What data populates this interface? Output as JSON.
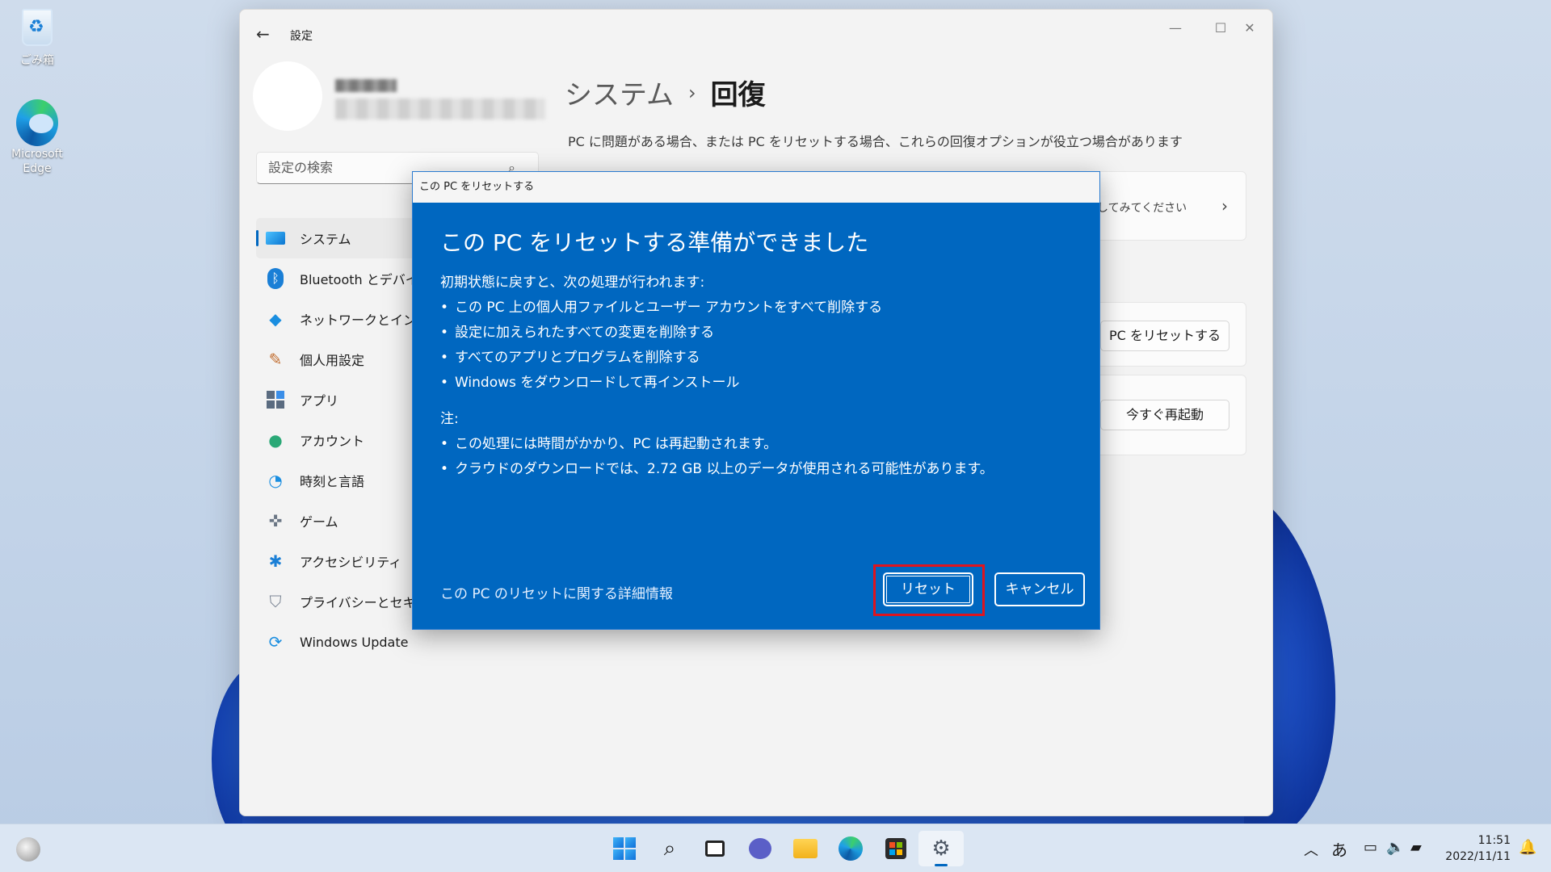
{
  "desktop": {
    "icons": [
      {
        "label": "ごみ箱",
        "icon": "recycle-bin-icon"
      },
      {
        "label": "Microsoft Edge",
        "icon": "edge-icon"
      }
    ]
  },
  "window": {
    "app_title": "設定",
    "search_placeholder": "設定の検索",
    "breadcrumb": {
      "parent": "システム",
      "separator": "›",
      "current": "回復"
    },
    "page_description": "PC に問題がある場合、または PC をリセットする場合、これらの回復オプションが役立つ場合があります",
    "nav": [
      {
        "label": "システム",
        "icon": "monitor-icon",
        "active": true
      },
      {
        "label": "Bluetooth とデバイス",
        "icon": "bluetooth-icon"
      },
      {
        "label": "ネットワークとインターネット",
        "icon": "wifi-icon"
      },
      {
        "label": "個人用設定",
        "icon": "brush-icon"
      },
      {
        "label": "アプリ",
        "icon": "apps-icon"
      },
      {
        "label": "アカウント",
        "icon": "account-icon"
      },
      {
        "label": "時刻と言語",
        "icon": "globe-clock-icon"
      },
      {
        "label": "ゲーム",
        "icon": "gamepad-icon"
      },
      {
        "label": "アクセシビリティ",
        "icon": "accessibility-icon"
      },
      {
        "label": "プライバシーとセキュリティ",
        "icon": "shield-icon"
      },
      {
        "label": "Windows Update",
        "icon": "update-icon"
      }
    ],
    "cards": {
      "troubleshoot_text": "決してみてください",
      "reset_button": "PC をリセットする",
      "restart_button": "今すぐ再起動"
    }
  },
  "dialog": {
    "title": "この PC をリセットする",
    "heading": "この PC をリセットする準備ができました",
    "intro": "初期状態に戻すと、次の処理が行われます:",
    "actions": [
      "この PC 上の個人用ファイルとユーザー アカウントをすべて削除する",
      "設定に加えられたすべての変更を削除する",
      "すべてのアプリとプログラムを削除する",
      "Windows をダウンロードして再インストール"
    ],
    "note_label": "注:",
    "notes": [
      "この処理には時間がかかり、PC は再起動されます。",
      "クラウドのダウンロードでは、2.72 GB 以上のデータが使用される可能性があります。"
    ],
    "link": "この PC のリセットに関する詳細情報",
    "reset_button": "リセット",
    "cancel_button": "キャンセル",
    "accent_color": "#0067c0",
    "highlight_color": "#e0141e"
  },
  "taskbar": {
    "apps": [
      "start-icon",
      "search-icon",
      "task-view-icon",
      "chat-icon",
      "file-explorer-icon",
      "edge-icon",
      "store-icon",
      "settings-icon"
    ],
    "tray": {
      "ime": "あ"
    },
    "time": "11:51",
    "date": "2022/11/11"
  }
}
